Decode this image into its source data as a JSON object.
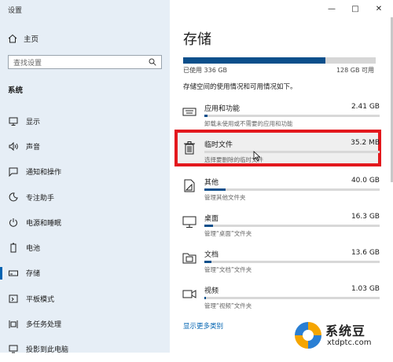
{
  "window": {
    "title": "设置",
    "minimize": "—",
    "maximize": "□",
    "close": "✕"
  },
  "sidebar": {
    "home": "主页",
    "search_placeholder": "查找设置",
    "section": "系统",
    "items": [
      {
        "label": "显示",
        "icon": "display-icon"
      },
      {
        "label": "声音",
        "icon": "sound-icon"
      },
      {
        "label": "通知和操作",
        "icon": "notifications-icon"
      },
      {
        "label": "专注助手",
        "icon": "focus-assist-icon"
      },
      {
        "label": "电源和睡眠",
        "icon": "power-icon"
      },
      {
        "label": "电池",
        "icon": "battery-icon"
      },
      {
        "label": "存储",
        "icon": "storage-icon",
        "active": true
      },
      {
        "label": "平板模式",
        "icon": "tablet-icon"
      },
      {
        "label": "多任务处理",
        "icon": "multitask-icon"
      },
      {
        "label": "投影到此电脑",
        "icon": "project-icon"
      }
    ]
  },
  "main": {
    "title": "存储",
    "used": "已使用 336 GB",
    "total": "128 GB 可用",
    "used_fraction": 0.74,
    "description": "存储空间的使用情况和可用情况如下。",
    "categories": [
      {
        "name": "应用和功能",
        "size": "2.41 GB",
        "desc": "卸载未使用或不需要的应用和功能",
        "fraction": 0.02
      },
      {
        "name": "临时文件",
        "size": "35.2 MB",
        "desc": "选择要删除的临时文件",
        "fraction": 0.0
      },
      {
        "name": "其他",
        "size": "40.0 GB",
        "desc": "管理其他文件夹",
        "fraction": 0.12
      },
      {
        "name": "桌面",
        "size": "16.3 GB",
        "desc": "管理“桌面”文件夹",
        "fraction": 0.05
      },
      {
        "name": "文档",
        "size": "13.6 GB",
        "desc": "管理“文档”文件夹",
        "fraction": 0.04
      },
      {
        "name": "视频",
        "size": "1.03 GB",
        "desc": "管理“视频”文件夹",
        "fraction": 0.01
      }
    ],
    "more_link": "显示更多类别"
  },
  "watermark": {
    "name": "系统豆",
    "url": "xtdptc.com"
  },
  "colors": {
    "accent": "#0063b1",
    "bar_fill": "#0c4f8b",
    "highlight": "#e3181d",
    "sidebar_bg": "#e6eef6"
  }
}
